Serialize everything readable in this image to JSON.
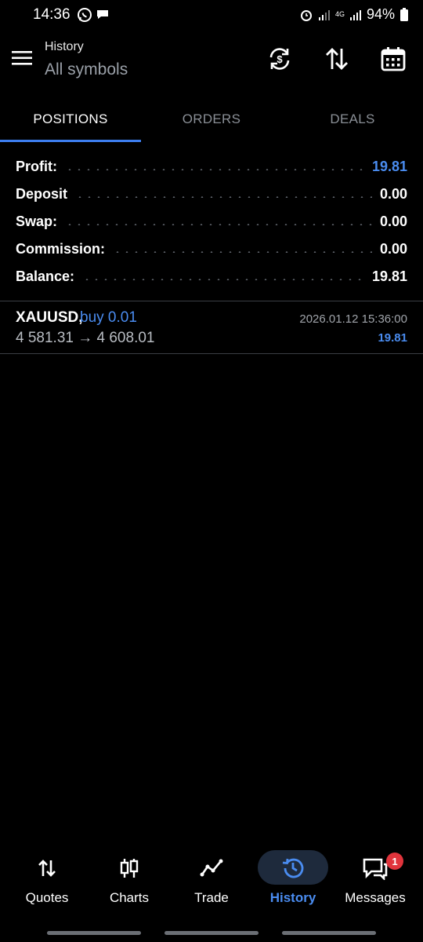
{
  "status_bar": {
    "time": "14:36",
    "battery": "94%",
    "network": "4G"
  },
  "header": {
    "title": "History",
    "subtitle": "All symbols",
    "icons": [
      "currency-exchange-icon",
      "sort-icon",
      "calendar-icon"
    ]
  },
  "tabs": [
    {
      "label": "POSITIONS",
      "active": true
    },
    {
      "label": "ORDERS",
      "active": false
    },
    {
      "label": "DEALS",
      "active": false
    }
  ],
  "summary": {
    "profit": {
      "label": "Profit:",
      "value": "19.81"
    },
    "deposit": {
      "label": "Deposit",
      "value": "0.00"
    },
    "swap": {
      "label": "Swap:",
      "value": "0.00"
    },
    "commission": {
      "label": "Commission:",
      "value": "0.00"
    },
    "balance": {
      "label": "Balance:",
      "value": "19.81"
    }
  },
  "positions": [
    {
      "symbol": "XAUUSD,",
      "side": "buy 0.01",
      "prices": "4 581.31 → 4 608.01",
      "time": "2026.01.12 15:36:00",
      "profit": "19.81"
    }
  ],
  "bottom_nav": [
    {
      "label": "Quotes",
      "icon": "quotes-arrows-icon",
      "active": false
    },
    {
      "label": "Charts",
      "icon": "candlestick-icon",
      "active": false
    },
    {
      "label": "Trade",
      "icon": "trade-line-icon",
      "active": false
    },
    {
      "label": "History",
      "icon": "history-clock-icon",
      "active": true
    },
    {
      "label": "Messages",
      "icon": "messages-icon",
      "active": false,
      "badge": "1"
    }
  ],
  "colors": {
    "accent": "#4a8cf0",
    "background": "#000000",
    "badge": "#e0343c"
  }
}
